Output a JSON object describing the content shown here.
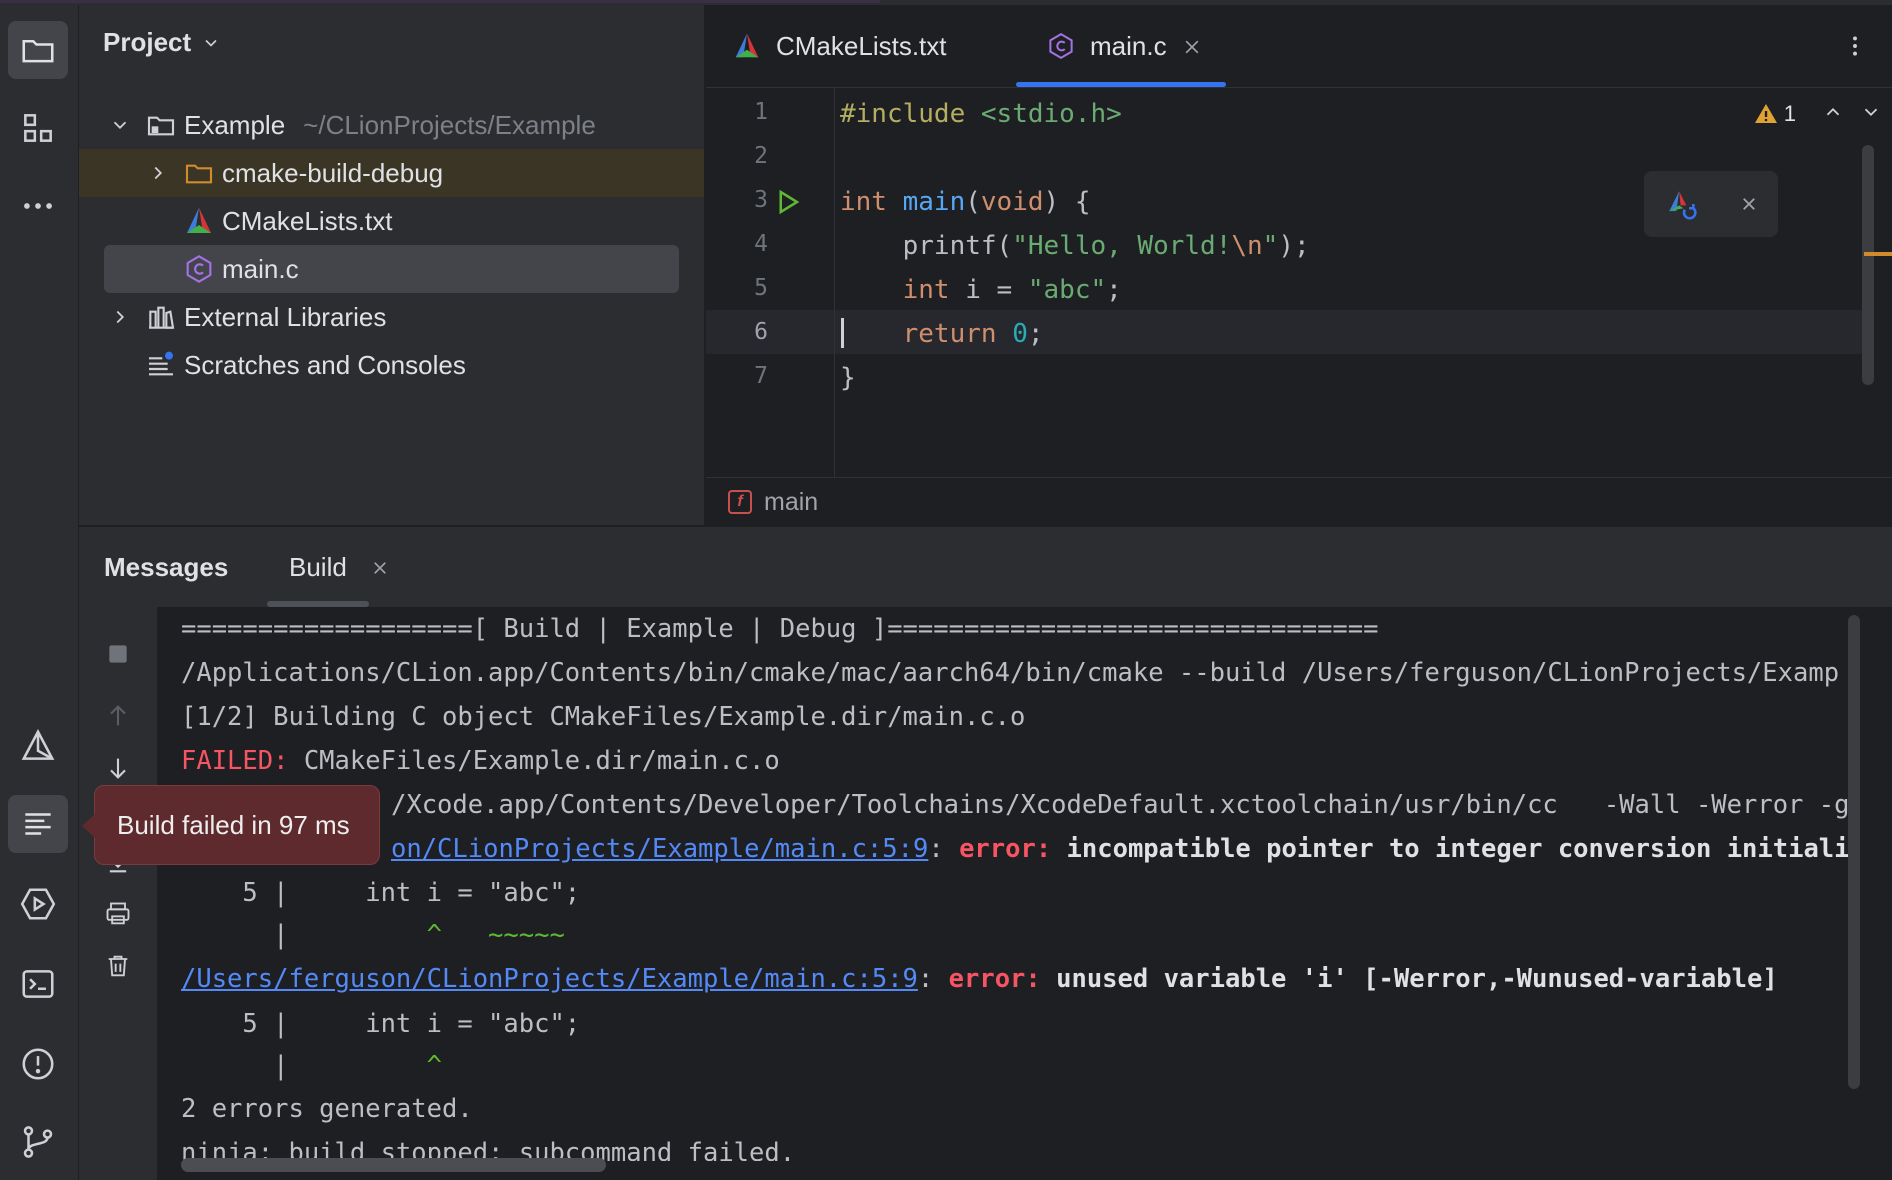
{
  "project_panel": {
    "title": "Project",
    "tree": [
      {
        "label": "Example",
        "path": "~/CLionProjects/Example",
        "icon": "folder-icon"
      },
      {
        "label": "cmake-build-debug",
        "icon": "folder-icon"
      },
      {
        "label": "CMakeLists.txt",
        "icon": "cmake-icon"
      },
      {
        "label": "main.c",
        "icon": "c-file-icon"
      },
      {
        "label": "External Libraries",
        "icon": "library-icon"
      },
      {
        "label": "Scratches and Consoles",
        "icon": "scratches-icon"
      }
    ]
  },
  "editor": {
    "tabs": [
      {
        "label": "CMakeLists.txt"
      },
      {
        "label": "main.c",
        "active": true
      }
    ],
    "line_numbers": [
      "1",
      "2",
      "3",
      "4",
      "5",
      "6",
      "7"
    ],
    "current_line": "6",
    "code": {
      "l1_directive": "#include",
      "l1_header": " <stdio.h>",
      "l3_type": "int",
      "l3_fn": " main",
      "l3_paren": "(",
      "l3_void": "void",
      "l3_rest": ") {",
      "l4_fn": "    printf",
      "l4_open": "(",
      "l4_str": "\"Hello, World!",
      "l4_esc": "\\n",
      "l4_strend": "\"",
      "l4_close": ");",
      "l5_type": "    int",
      "l5_var": " i",
      "l5_eq": " = ",
      "l5_str": "\"abc\"",
      "l5_semi": ";",
      "l6_kw": "    return",
      "l6_num": " 0",
      "l6_semi": ";",
      "l7": "}"
    },
    "warning_count": "1",
    "breadcrumb": "main",
    "breadcrumb_icon_letter": "f"
  },
  "bottom_panel": {
    "tabs": [
      {
        "label": "Messages"
      },
      {
        "label": "Build",
        "selected": true
      }
    ],
    "console": {
      "line1": "===================[ Build | Example | Debug ]================================",
      "line2": "/Applications/CLion.app/Contents/bin/cmake/mac/aarch64/bin/cmake --build /Users/ferguson/CLionProjects/Examp",
      "line3": "[1/2] Building C object CMakeFiles/Example.dir/main.c.o",
      "line4_failed": "FAILED:",
      "line4_rest": " CMakeFiles/Example.dir/main.c.o",
      "line5": "/Xcode.app/Contents/Developer/Toolchains/XcodeDefault.xctoolchain/usr/bin/cc   -Wall -Werror -g",
      "line6_link": "on/CLionProjects/Example/main.c:5:9",
      "line6_colon": ": ",
      "line6_error": "error:",
      "line6_msg": " incompatible pointer to integer conversion initiali",
      "line7": "    5 |     int i = \"abc\";",
      "line8_bar": "      |",
      "line8_caret": "         ^   ~~~~~",
      "line9_link": "/Users/ferguson/CLionProjects/Example/main.c:5:9",
      "line9_colon": ": ",
      "line9_error": "error:",
      "line9_msg": " unused variable 'i' [-Werror,-Wunused-variable]",
      "line10": "    5 |     int i = \"abc\";",
      "line11_bar": "      |",
      "line11_caret": "         ^",
      "line12": "2 errors generated.",
      "line13": "ninja: build stopped: subcommand failed."
    }
  },
  "tooltip": {
    "text": "Build failed in 97 ms"
  },
  "colors": {
    "accent": "#3574f0",
    "error": "#f75464",
    "link": "#548af7"
  }
}
